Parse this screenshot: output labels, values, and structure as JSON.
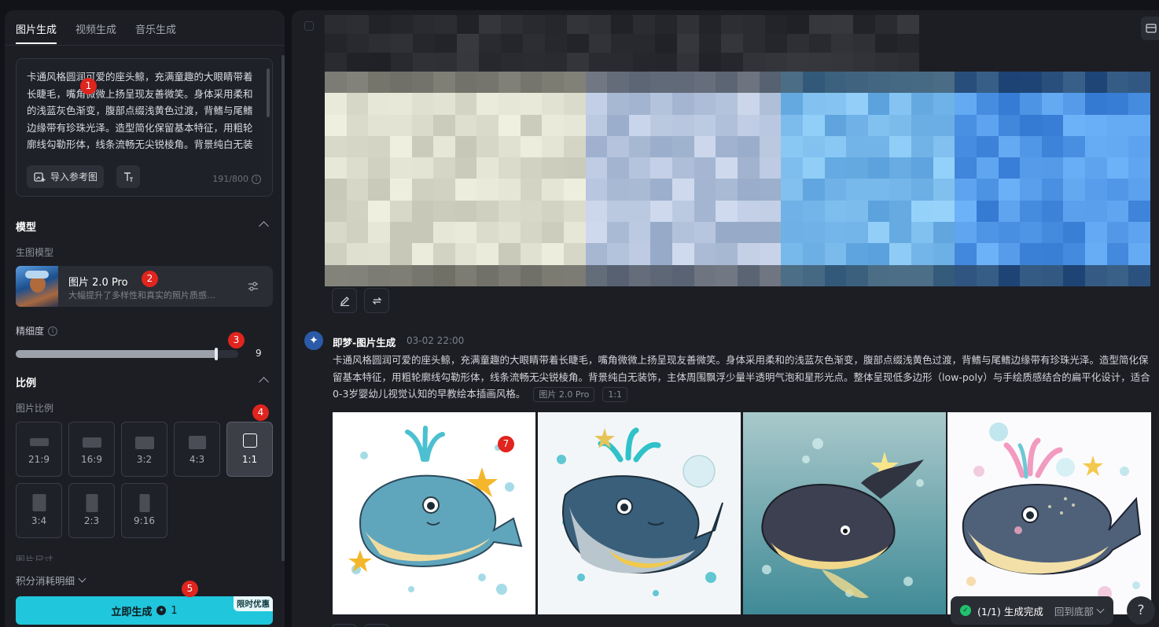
{
  "tabs": [
    {
      "label": "图片生成",
      "active": true
    },
    {
      "label": "视频生成",
      "active": false
    },
    {
      "label": "音乐生成",
      "active": false
    }
  ],
  "prompt": {
    "text": "卡通风格圆润可爱的座头鲸，充满童趣的大眼睛带着长睫毛，嘴角微微上扬呈现友善微笑。身体采用柔和的浅蓝灰色渐变，腹部点缀浅黄色过渡，背鳍与尾鳍边缘带有珍珠光泽。造型简化保留基本特征，用粗轮廓线勾勒形体，线条流畅无尖锐棱角。背景纯白无装饰，主体周围飘浮少量半透明气泡和星形光点。",
    "import_ref_label": "导入参考图",
    "counter": "191/800"
  },
  "model_section": {
    "title": "模型",
    "sub_label": "生图模型",
    "model_name": "图片 2.0 Pro",
    "model_desc": "大幅提升了多样性和真实的照片质感…"
  },
  "detail": {
    "label": "精细度",
    "value": "9",
    "fraction": 0.9
  },
  "ratio_section": {
    "title": "比例",
    "sub_label": "图片比例",
    "options": [
      "21:9",
      "16:9",
      "3:2",
      "4:3",
      "1:1",
      "3:4",
      "2:3",
      "9:16"
    ],
    "selected": "1:1",
    "next_label": "图片尺寸"
  },
  "footer": {
    "credit_link": "积分消耗明细",
    "generate_label": "立即生成",
    "coin_cost": "1",
    "promo": "限时优惠"
  },
  "message": {
    "author": "即梦-图片生成",
    "time": "03-02  22:00",
    "text": "卡通风格圆润可爱的座头鲸，充满童趣的大眼睛带着长睫毛，嘴角微微上扬呈现友善微笑。身体采用柔和的浅蓝灰色渐变，腹部点缀浅黄色过渡，背鳍与尾鳍边缘带有珍珠光泽。造型简化保留基本特征，用粗轮廓线勾勒形体，线条流畅无尖锐棱角。背景纯白无装饰，主体周围飘浮少量半透明气泡和星形光点。整体呈现低多边形（low-poly）与手绘质感结合的扁平化设计，适合0-3岁婴幼儿视觉认知的早教绘本插画风格。",
    "tag_model": "图片 2.0 Pro",
    "tag_ratio": "1:1"
  },
  "toast": {
    "status": "(1/1) 生成完成",
    "link": "回到底部"
  },
  "help_label": "?",
  "badges": [
    "1",
    "2",
    "3",
    "4",
    "5",
    "7"
  ],
  "colors": {
    "accent": "#20c6dc",
    "panel": "#1c1e24",
    "background": "#121318",
    "badge": "#e0241e"
  }
}
